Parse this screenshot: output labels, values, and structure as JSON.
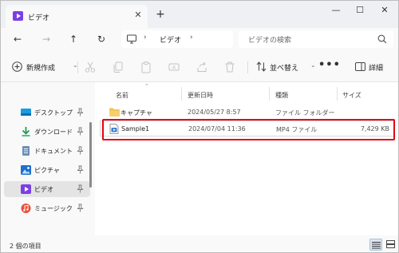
{
  "tab": {
    "title": "ビデオ",
    "icon": "video-folder-icon"
  },
  "window_controls": {
    "minimize": "—",
    "maximize": "☐",
    "close": "✕"
  },
  "new_tab_label": "+",
  "nav": {
    "back": "←",
    "forward": "→",
    "up": "↑",
    "refresh": "↻",
    "address_crumbs": [
      "ビデオ"
    ],
    "search_placeholder": "ビデオの検索"
  },
  "command_bar": {
    "new_label": "新規作成",
    "sort_label": "並べ替え",
    "more_label": "•••",
    "details_label": "詳細",
    "icons": [
      "cut-icon",
      "copy-icon",
      "paste-icon",
      "rename-icon",
      "share-icon",
      "delete-icon"
    ]
  },
  "sidebar": {
    "items": [
      {
        "label": "デスクトップ",
        "icon": "desktop-icon",
        "pinned": true,
        "selected": false
      },
      {
        "label": "ダウンロード",
        "icon": "download-icon",
        "pinned": true,
        "selected": false
      },
      {
        "label": "ドキュメント",
        "icon": "documents-icon",
        "pinned": true,
        "selected": false
      },
      {
        "label": "ピクチャ",
        "icon": "pictures-icon",
        "pinned": true,
        "selected": false
      },
      {
        "label": "ビデオ",
        "icon": "videos-icon",
        "pinned": true,
        "selected": true
      },
      {
        "label": "ミュージック",
        "icon": "music-icon",
        "pinned": true,
        "selected": false
      }
    ]
  },
  "columns": {
    "name": "名前",
    "date": "更新日時",
    "type": "種類",
    "size": "サイズ"
  },
  "files": [
    {
      "name": "キャプチャ",
      "date": "2024/05/27 8:57",
      "type": "ファイル フォルダー",
      "size": "",
      "icon": "folder-icon"
    },
    {
      "name": "Sample1",
      "date": "2024/07/04 11:36",
      "type": "MP4 ファイル",
      "size": "7,429 KB",
      "icon": "video-file-icon"
    }
  ],
  "status": {
    "item_count": "2 個の項目"
  },
  "colors": {
    "accent": "#0067c0",
    "highlight": "#e60012",
    "folder": "#f2c14e",
    "video": "#7b3fe4"
  }
}
